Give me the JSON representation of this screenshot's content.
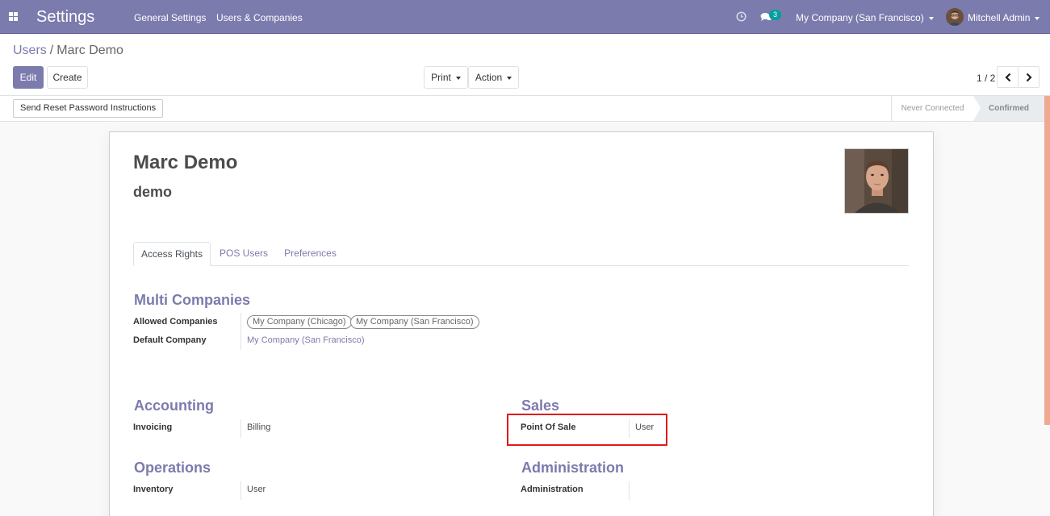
{
  "navbar": {
    "app_title": "Settings",
    "menu": [
      "General Settings",
      "Users & Companies"
    ],
    "chat_count": "3",
    "company": "My Company (San Francisco)",
    "user": "Mitchell Admin"
  },
  "breadcrumb": {
    "parent": "Users",
    "separator": "/",
    "current": "Marc Demo"
  },
  "toolbar": {
    "edit_label": "Edit",
    "create_label": "Create",
    "print_label": "Print",
    "action_label": "Action"
  },
  "pager": {
    "value": "1 / 2"
  },
  "statusbar": {
    "reset_label": "Send Reset Password Instructions",
    "stages": [
      "Never Connected",
      "Confirmed"
    ],
    "active_stage": "Confirmed"
  },
  "record": {
    "name": "Marc Demo",
    "login": "demo"
  },
  "tabs": [
    {
      "label": "Access Rights",
      "active": true
    },
    {
      "label": "POS Users",
      "active": false
    },
    {
      "label": "Preferences",
      "active": false
    }
  ],
  "multi_companies": {
    "title": "Multi Companies",
    "allowed_label": "Allowed Companies",
    "allowed": [
      "My Company (Chicago)",
      "My Company (San Francisco)"
    ],
    "default_label": "Default Company",
    "default": "My Company (San Francisco)"
  },
  "accounting": {
    "title": "Accounting",
    "field_label": "Invoicing",
    "value": "Billing"
  },
  "sales": {
    "title": "Sales",
    "field_label": "Point Of Sale",
    "value": "User"
  },
  "operations": {
    "title": "Operations",
    "field_label": "Inventory",
    "value": "User"
  },
  "administration": {
    "title": "Administration",
    "field_label": "Administration",
    "value": ""
  },
  "colors": {
    "brand": "#7c7bad",
    "highlight": "#e01b1b",
    "badge": "#00a09d"
  }
}
